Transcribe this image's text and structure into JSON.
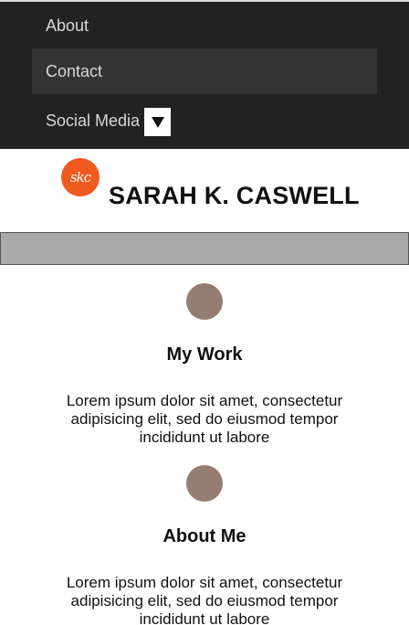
{
  "nav": {
    "items": [
      {
        "label": "About"
      },
      {
        "label": "Contact"
      },
      {
        "label": "Social Media"
      }
    ]
  },
  "header": {
    "logo_text": "skc",
    "title": "SARAH K. CASWELL"
  },
  "sections": [
    {
      "title": "My Work",
      "text": "Lorem ipsum dolor sit amet, consectetur adipisicing elit, sed do eiusmod tempor incididunt ut labore"
    },
    {
      "title": "About Me",
      "text": "Lorem ipsum dolor sit amet, consectetur adipisicing elit, sed do eiusmod tempor incididunt ut labore"
    }
  ],
  "colors": {
    "nav_bg": "#222222",
    "nav_active_bg": "#333333",
    "logo_bg": "#ef5a1f",
    "banner_bg": "#aaaaaa",
    "section_icon": "#957e71"
  },
  "icons": {
    "dropdown": "caret-down-icon",
    "section": "circle-icon"
  }
}
